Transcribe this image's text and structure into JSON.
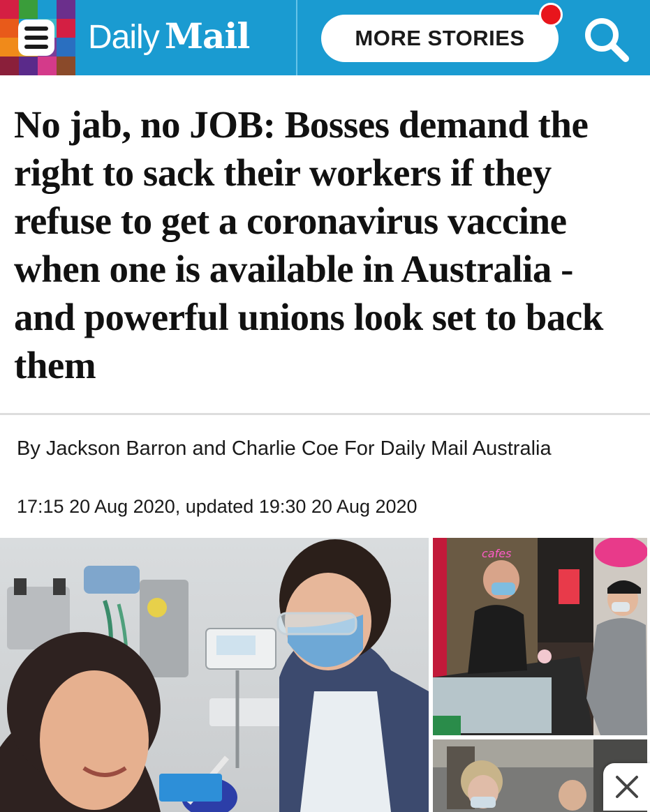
{
  "header": {
    "logo_part1": "Daily",
    "logo_part2": "Mail",
    "more_stories_label": "MORE STORIES",
    "menu_icon": "hamburger-menu-icon",
    "search_icon": "search-icon",
    "notification_icon": "notification-dot",
    "bar_color": "#1a9bd1",
    "notification_color": "#e8151c"
  },
  "article": {
    "headline": "No jab, no JOB: Bosses demand the right to sack their workers if they refuse to get a coronavirus vaccine when one is available in Australia - and powerful unions look set to back them",
    "byline": "By Jackson Barron and Charlie Coe For Daily Mail Australia",
    "dateline": "17:15 20 Aug 2020, updated 19:30 20 Aug 2020"
  },
  "overlay": {
    "close_icon": "close-icon"
  }
}
